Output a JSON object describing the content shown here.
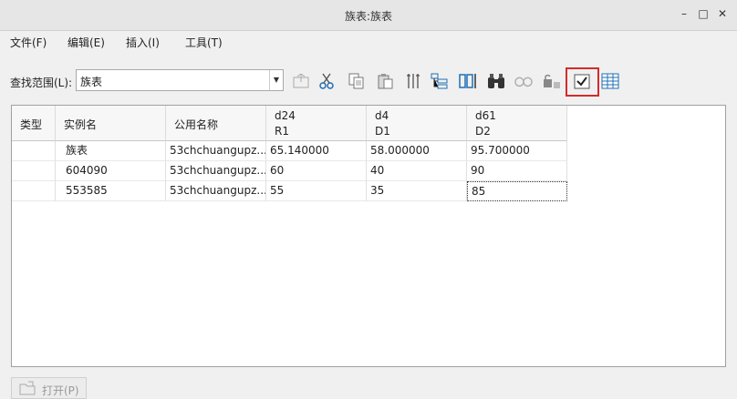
{
  "window": {
    "title": "族表:族表",
    "controls": [
      "–",
      "□",
      "✕"
    ]
  },
  "menu": [
    {
      "label": "文件(F)"
    },
    {
      "label": "编辑(E)"
    },
    {
      "label": "插入(I)"
    },
    {
      "label": "工具(T)"
    }
  ],
  "toolbar": {
    "scope_label": "查找范围(L):",
    "scope_value": "族表",
    "icons": [
      "go-up-icon",
      "cut-icon",
      "copy-icon",
      "paste-icon",
      "insert-column-icon",
      "structure-icon",
      "column-edit-icon",
      "find-binoculars-icon",
      "glasses-icon",
      "lock-icon",
      "verify-checkmark-icon",
      "table-view-icon"
    ]
  },
  "grid": {
    "columns": [
      {
        "line1": "类型",
        "line2": ""
      },
      {
        "line1": "实例名",
        "line2": ""
      },
      {
        "line1": "公用名称",
        "line2": ""
      },
      {
        "line1": "d24",
        "line2": "R1"
      },
      {
        "line1": "d4",
        "line2": "D1"
      },
      {
        "line1": "d61",
        "line2": "D2"
      }
    ],
    "rows": [
      [
        "",
        "族表",
        "53chchuangupz...",
        "65.140000",
        "58.000000",
        "95.700000"
      ],
      [
        "",
        "604090",
        "53chchuangupz...",
        "60",
        "40",
        "90"
      ],
      [
        "",
        "553585",
        "53chchuangupz...",
        "55",
        "35",
        "85"
      ]
    ]
  },
  "footer": {
    "open_label": "打开(P)"
  }
}
